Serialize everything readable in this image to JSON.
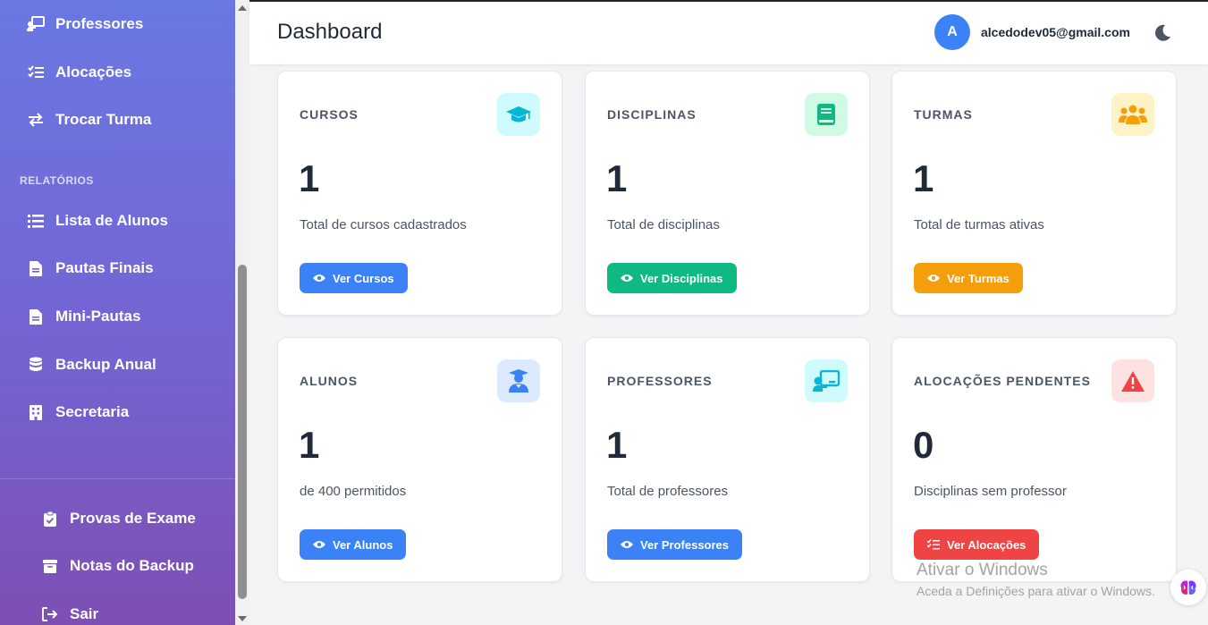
{
  "sidebar": {
    "items_top": [
      {
        "label": "Professores",
        "icon": "chalkboard-teacher-icon"
      },
      {
        "label": "Alocações",
        "icon": "list-check-icon"
      },
      {
        "label": "Trocar Turma",
        "icon": "exchange-icon"
      }
    ],
    "section_title": "RELATÓRIOS",
    "items_reports": [
      {
        "label": "Lista de Alunos",
        "icon": "list-icon"
      },
      {
        "label": "Pautas Finais",
        "icon": "file-icon"
      },
      {
        "label": "Mini-Pautas",
        "icon": "file-alt-icon"
      },
      {
        "label": "Backup Anual",
        "icon": "database-icon"
      },
      {
        "label": "Secretaria",
        "icon": "building-icon"
      }
    ],
    "items_bottom": [
      {
        "label": "Provas de Exame",
        "icon": "clipboard-check-icon"
      },
      {
        "label": "Notas do Backup",
        "icon": "archive-icon"
      },
      {
        "label": "Sair",
        "icon": "sign-out-icon"
      }
    ]
  },
  "header": {
    "title": "Dashboard",
    "avatar_letter": "A",
    "email": "alcedodev05@gmail.com",
    "theme_icon": "moon-icon"
  },
  "cards": [
    {
      "title": "CURSOS",
      "value": "1",
      "desc": "Total de cursos cadastrados",
      "button": "Ver Cursos",
      "icon": "graduation-cap-icon",
      "color": "#3b82f6",
      "icon_bg": "#cffafe",
      "icon_color": "#06b6d4"
    },
    {
      "title": "DISCIPLINAS",
      "value": "1",
      "desc": "Total de disciplinas",
      "button": "Ver Disciplinas",
      "icon": "book-icon",
      "color": "#10b981",
      "icon_bg": "#d1fae5",
      "icon_color": "#10b981"
    },
    {
      "title": "TURMAS",
      "value": "1",
      "desc": "Total de turmas ativas",
      "button": "Ver Turmas",
      "icon": "users-icon",
      "color": "#f59e0b",
      "icon_bg": "#fef3c7",
      "icon_color": "#f59e0b"
    },
    {
      "title": "ALUNOS",
      "value": "1",
      "desc": "de 400 permitidos",
      "button": "Ver Alunos",
      "icon": "user-graduate-icon",
      "color": "#3b82f6",
      "icon_bg": "#dbeafe",
      "icon_color": "#3b82f6"
    },
    {
      "title": "PROFESSORES",
      "value": "1",
      "desc": "Total de professores",
      "button": "Ver Professores",
      "icon": "chalkboard-teacher-icon",
      "color": "#3b82f6",
      "icon_bg": "#cffafe",
      "icon_color": "#06b6d4"
    },
    {
      "title": "ALOCAÇÕES PENDENTES",
      "value": "0",
      "desc": "Disciplinas sem professor",
      "button": "Ver Alocações",
      "icon": "warning-icon",
      "color": "#ef4444",
      "icon_bg": "#fee2e2",
      "icon_color": "#ef4444"
    }
  ],
  "watermark": {
    "line1": "Ativar o Windows",
    "line2": "Aceda a Definições para ativar o Windows."
  }
}
